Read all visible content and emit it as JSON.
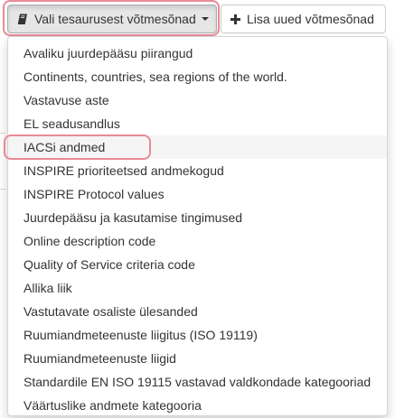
{
  "toolbar": {
    "thesaurus_button": {
      "label": "Vali tesaurusest võtmesõnad",
      "icon": "book-icon"
    },
    "add_button": {
      "label": "Lisa uued võtmesõnad",
      "icon": "plus-icon"
    }
  },
  "menu": {
    "items": [
      "Avaliku juurdepääsu piirangud",
      "Continents, countries, sea regions of the world.",
      "Vastavuse aste",
      "EL seadusandlus",
      "IACSi andmed",
      "INSPIRE prioriteetsed andmekogud",
      "INSPIRE Protocol values",
      "Juurdepääsu ja kasutamise tingimused",
      "Online description code",
      "Quality of Service criteria code",
      "Allika liik",
      "Vastutavate osaliste ülesanded",
      "Ruumiandmeteenuste liigitus (ISO 19119)",
      "Ruumiandmeteenuste liigid",
      "Standardile EN ISO 19115 vastavad valdkondade kategooriad",
      "Väärtuslike andmete kategooria"
    ],
    "hovered_index": 4
  },
  "colors": {
    "highlight": "#e88a96",
    "hover_background": "#f5f5f5"
  }
}
